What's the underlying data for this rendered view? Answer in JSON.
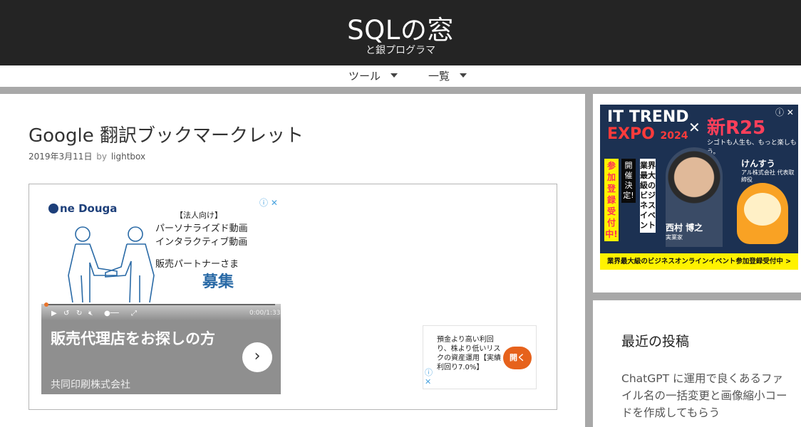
{
  "site": {
    "title": "SQLの窓",
    "description": "と銀プログラマ"
  },
  "nav": {
    "items": [
      {
        "label": "ツール"
      },
      {
        "label": "一覧"
      }
    ]
  },
  "post": {
    "title": "Google 翻訳ブックマークレット",
    "date": "2019年3月11日",
    "by": "by",
    "author": "lightbox"
  },
  "ad_left": {
    "logo": "ne Douga",
    "choice": "ⓘ ✕",
    "lines": [
      "【法人向け】",
      "パーソナライズド動画",
      "インタラクティブ動画",
      "販売パートナーさま"
    ],
    "big": "募集",
    "time": "0:00/1:33",
    "headline": "販売代理店をお探しの方",
    "sponsor": "共同印刷株式会社",
    "arrow": "›"
  },
  "ad_right": {
    "text": "預金より高い利回り、株より低いリスクの資産運用【実績利回り7.0%】",
    "button": "開く",
    "choice_i": "ⓘ",
    "choice_x": "✕"
  },
  "sidebar_banner": {
    "title1": "IT TREND",
    "title2": "EXPO",
    "year": "2024",
    "cross": "✕",
    "brand": "新R25",
    "tagline": "シゴトも人生も、もっと楽しもう。",
    "vert1": "参加登録受付中!",
    "vert2": "開催決定!",
    "vert3": "業界最大級のビジネスイベント",
    "person1": "西村 博之",
    "person1_role": "実業家",
    "person2": "けんすう",
    "person2_role": "アル株式会社 代表取締役",
    "footer": "業界最大級のビジネスオンラインイベント参加登録受付中 >",
    "choice": "ⓘ ✕"
  },
  "widget": {
    "title": "最近の投稿",
    "item": "ChatGPT に運用で良くあるファイル名の一括変更と画像縮小コードを作成してもらう"
  }
}
